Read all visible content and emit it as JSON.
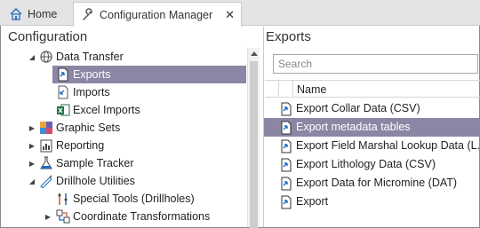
{
  "tabs": [
    {
      "label": "Home",
      "icon": "home-icon",
      "active": false
    },
    {
      "label": "Configuration Manager",
      "icon": "wrench-icon",
      "active": true,
      "close": "✕"
    }
  ],
  "left": {
    "title": "Configuration",
    "tree": [
      {
        "label": "Data Transfer",
        "icon": "globe-transfer-icon",
        "twisty": "expanded"
      },
      {
        "label": "Exports",
        "icon": "export-icon",
        "selected": true
      },
      {
        "label": "Imports",
        "icon": "import-icon"
      },
      {
        "label": "Excel Imports",
        "icon": "excel-icon"
      },
      {
        "label": "Graphic Sets",
        "icon": "graphic-sets-icon",
        "twisty": "collapsed"
      },
      {
        "label": "Reporting",
        "icon": "reporting-icon",
        "twisty": "collapsed"
      },
      {
        "label": "Sample Tracker",
        "icon": "flask-icon",
        "twisty": "collapsed"
      },
      {
        "label": "Drillhole Utilities",
        "icon": "drillhole-icon",
        "twisty": "expanded"
      },
      {
        "label": "Special Tools (Drillholes)",
        "icon": "special-tools-icon"
      },
      {
        "label": "Coordinate Transformations",
        "icon": "coordinate-icon",
        "twisty": "collapsed"
      }
    ]
  },
  "right": {
    "title": "Exports",
    "search_placeholder": "Search",
    "column_name": "Name",
    "rows": [
      {
        "label": "Export Collar Data (CSV)",
        "selected": false
      },
      {
        "label": "Export metadata tables",
        "selected": true
      },
      {
        "label": "Export Field Marshal Lookup Data (L...",
        "selected": false
      },
      {
        "label": "Export Lithology Data (CSV)",
        "selected": false
      },
      {
        "label": "Export Data for Micromine (DAT)",
        "selected": false
      },
      {
        "label": "Export",
        "selected": false
      }
    ]
  },
  "colors": {
    "selection": "#8c86a5",
    "accent": "#1c6dc2"
  }
}
